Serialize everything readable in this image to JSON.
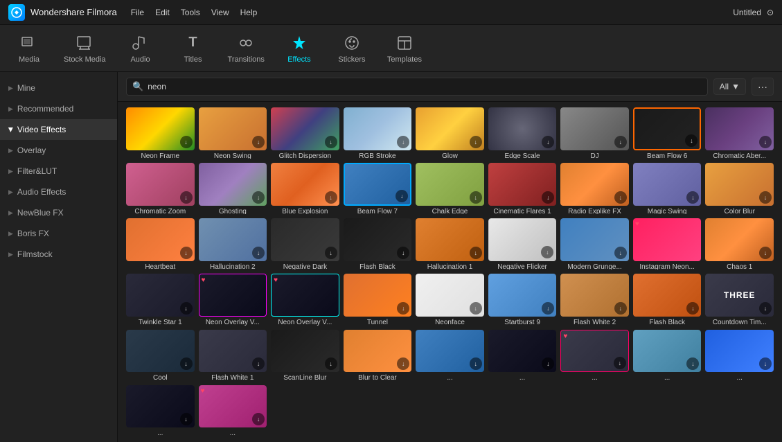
{
  "app": {
    "brand": "Wondershare Filmora",
    "title": "Untitled"
  },
  "menu": {
    "items": [
      "File",
      "Edit",
      "Tools",
      "View",
      "Help"
    ]
  },
  "toolbar": {
    "items": [
      {
        "id": "media",
        "label": "Media",
        "icon": "🎬"
      },
      {
        "id": "stock-media",
        "label": "Stock Media",
        "icon": "🗂"
      },
      {
        "id": "audio",
        "label": "Audio",
        "icon": "🎵"
      },
      {
        "id": "titles",
        "label": "Titles",
        "icon": "T"
      },
      {
        "id": "transitions",
        "label": "Transitions",
        "icon": "⟷"
      },
      {
        "id": "effects",
        "label": "Effects",
        "icon": "✦"
      },
      {
        "id": "stickers",
        "label": "Stickers",
        "icon": "🌀"
      },
      {
        "id": "templates",
        "label": "Templates",
        "icon": "⬜"
      }
    ]
  },
  "sidebar": {
    "items": [
      {
        "id": "mine",
        "label": "Mine",
        "expanded": false
      },
      {
        "id": "recommended",
        "label": "Recommended",
        "expanded": false
      },
      {
        "id": "video-effects",
        "label": "Video Effects",
        "expanded": true,
        "active": true
      },
      {
        "id": "overlay",
        "label": "Overlay",
        "expanded": false
      },
      {
        "id": "filter-lut",
        "label": "Filter&LUT",
        "expanded": false
      },
      {
        "id": "audio-effects",
        "label": "Audio Effects",
        "expanded": false
      },
      {
        "id": "newblue-fx",
        "label": "NewBlue FX",
        "expanded": false
      },
      {
        "id": "boris-fx",
        "label": "Boris FX",
        "expanded": false
      },
      {
        "id": "filmstock",
        "label": "Filmstock",
        "expanded": false
      }
    ]
  },
  "search": {
    "value": "neon",
    "placeholder": "neon",
    "filter": "All"
  },
  "effects": [
    {
      "id": "neon-frame",
      "name": "Neon Frame",
      "thumb": "thumb-neon-frame",
      "hasDownload": true,
      "hasHeart": false,
      "selected": false
    },
    {
      "id": "neon-swing",
      "name": "Neon Swing",
      "thumb": "thumb-neon-swing",
      "hasDownload": true,
      "hasHeart": false,
      "selected": false
    },
    {
      "id": "glitch-dispersion",
      "name": "Glitch Dispersion",
      "thumb": "thumb-glitch-disp",
      "hasDownload": true,
      "hasHeart": false,
      "selected": false
    },
    {
      "id": "rgb-stroke",
      "name": "RGB Stroke",
      "thumb": "thumb-rgb-stroke",
      "hasDownload": true,
      "hasHeart": false,
      "selected": false
    },
    {
      "id": "glow",
      "name": "Glow",
      "thumb": "thumb-glow",
      "hasDownload": true,
      "hasHeart": false,
      "selected": false
    },
    {
      "id": "edge-scale",
      "name": "Edge Scale",
      "thumb": "thumb-edge-scale",
      "hasDownload": true,
      "hasHeart": false,
      "selected": false
    },
    {
      "id": "dj",
      "name": "DJ",
      "thumb": "thumb-dj",
      "hasDownload": true,
      "hasHeart": false,
      "selected": false
    },
    {
      "id": "beam-flow6",
      "name": "Beam Flow 6",
      "thumb": "thumb-beam-flow6",
      "hasDownload": true,
      "hasHeart": false,
      "selected": true
    },
    {
      "id": "chromatic-aberration",
      "name": "Chromatic Aber...",
      "thumb": "thumb-chromatic-aber",
      "hasDownload": true,
      "hasHeart": false,
      "selected": false
    },
    {
      "id": "chromatic-zoom",
      "name": "Chromatic Zoom",
      "thumb": "thumb-chromatic-zoom",
      "hasDownload": true,
      "hasHeart": false,
      "selected": false
    },
    {
      "id": "ghosting",
      "name": "Ghosting",
      "thumb": "thumb-ghosting",
      "hasDownload": true,
      "hasHeart": false,
      "selected": false
    },
    {
      "id": "blue-explosion",
      "name": "Blue Explosion",
      "thumb": "thumb-blue-explosion",
      "hasDownload": true,
      "hasHeart": false,
      "selected": false
    },
    {
      "id": "beam-flow7",
      "name": "Beam Flow 7",
      "thumb": "thumb-beam-flow7",
      "hasDownload": true,
      "hasHeart": false,
      "selected": false
    },
    {
      "id": "chalk-edge",
      "name": "Chalk Edge",
      "thumb": "thumb-chalk-edge",
      "hasDownload": true,
      "hasHeart": false,
      "selected": false
    },
    {
      "id": "cinematic-flares",
      "name": "Cinematic Flares 1",
      "thumb": "thumb-cinematic",
      "hasDownload": true,
      "hasHeart": false,
      "selected": false
    },
    {
      "id": "radio-explike",
      "name": "Radio Explike FX",
      "thumb": "thumb-radio-explike",
      "hasDownload": true,
      "hasHeart": false,
      "selected": false
    },
    {
      "id": "magic-swing",
      "name": "Magic Swing",
      "thumb": "thumb-magic-swing",
      "hasDownload": true,
      "hasHeart": false,
      "selected": false
    },
    {
      "id": "color-blur",
      "name": "Color Blur",
      "thumb": "thumb-color-blur",
      "hasDownload": true,
      "hasHeart": false,
      "selected": false
    },
    {
      "id": "heartbeat",
      "name": "Heartbeat",
      "thumb": "thumb-heartbeat",
      "hasDownload": true,
      "hasHeart": false,
      "selected": false
    },
    {
      "id": "hallucination2",
      "name": "Hallucination 2",
      "thumb": "thumb-hallucination2",
      "hasDownload": true,
      "hasHeart": false,
      "selected": false
    },
    {
      "id": "negative-dark",
      "name": "Negative Dark",
      "thumb": "thumb-negative-dark",
      "hasDownload": true,
      "hasHeart": false,
      "selected": false
    },
    {
      "id": "flash-black",
      "name": "Flash Black",
      "thumb": "thumb-flash-black",
      "hasDownload": true,
      "hasHeart": false,
      "selected": false
    },
    {
      "id": "hallucination1",
      "name": "Hallucination 1",
      "thumb": "thumb-hallucination1",
      "hasDownload": true,
      "hasHeart": false,
      "selected": false
    },
    {
      "id": "negative-flicker",
      "name": "Negative Flicker",
      "thumb": "thumb-negative-flicker",
      "hasDownload": true,
      "hasHeart": false,
      "selected": false
    },
    {
      "id": "modern-grunge",
      "name": "Modern Grunge...",
      "thumb": "thumb-modern-grunge",
      "hasDownload": true,
      "hasHeart": false,
      "selected": false
    },
    {
      "id": "instagram-neon",
      "name": "Instagram Neon...",
      "thumb": "thumb-instagram-neon",
      "hasDownload": false,
      "hasHeart": true,
      "selected": false
    },
    {
      "id": "chaos1",
      "name": "Chaos 1",
      "thumb": "thumb-chaos1",
      "hasDownload": true,
      "hasHeart": false,
      "selected": false
    },
    {
      "id": "twinkle-star",
      "name": "Twinkle Star 1",
      "thumb": "thumb-twinkle-star",
      "hasDownload": true,
      "hasHeart": false,
      "selected": false
    },
    {
      "id": "neon-overlay-v1",
      "name": "Neon Overlay V...",
      "thumb": "thumb-neon-overlay-v1",
      "hasDownload": false,
      "hasHeart": true,
      "selected": false
    },
    {
      "id": "neon-overlay-v2",
      "name": "Neon Overlay V...",
      "thumb": "thumb-neon-overlay-v2",
      "hasDownload": false,
      "hasHeart": true,
      "selected": false
    },
    {
      "id": "tunnel",
      "name": "Tunnel",
      "thumb": "thumb-tunnel",
      "hasDownload": true,
      "hasHeart": false,
      "selected": false
    },
    {
      "id": "neonface",
      "name": "Neonface",
      "thumb": "thumb-neonface",
      "hasDownload": true,
      "hasHeart": false,
      "selected": false
    },
    {
      "id": "startburst9",
      "name": "Startburst 9",
      "thumb": "thumb-startburst",
      "hasDownload": true,
      "hasHeart": false,
      "selected": false
    },
    {
      "id": "flash-white2",
      "name": "Flash White 2",
      "thumb": "thumb-flash-white2",
      "hasDownload": true,
      "hasHeart": false,
      "selected": false
    },
    {
      "id": "flash-black2",
      "name": "Flash Black",
      "thumb": "thumb-flash-black2",
      "hasDownload": true,
      "hasHeart": false,
      "selected": false
    },
    {
      "id": "countdown-time",
      "name": "Countdown Tim...",
      "thumb": "thumb-countdown",
      "hasDownload": true,
      "hasHeart": false,
      "selected": false,
      "label": "THREE"
    },
    {
      "id": "cool",
      "name": "Cool",
      "thumb": "thumb-cool",
      "hasDownload": true,
      "hasHeart": false,
      "selected": false
    },
    {
      "id": "flash-white1",
      "name": "Flash White 1",
      "thumb": "thumb-flash-white1",
      "hasDownload": true,
      "hasHeart": false,
      "selected": false
    },
    {
      "id": "scanline-blur",
      "name": "ScanLine Blur",
      "thumb": "thumb-scanline",
      "hasDownload": true,
      "hasHeart": false,
      "selected": false
    },
    {
      "id": "blur-to-clear",
      "name": "Blur to Clear",
      "thumb": "thumb-blur-to-clear",
      "hasDownload": true,
      "hasHeart": false,
      "selected": false
    },
    {
      "id": "bottom1",
      "name": "...",
      "thumb": "thumb-bottom1",
      "hasDownload": true,
      "hasHeart": false,
      "selected": false
    },
    {
      "id": "bottom2",
      "name": "...",
      "thumb": "thumb-bottom2",
      "hasDownload": true,
      "hasHeart": false,
      "selected": false
    },
    {
      "id": "bottom3",
      "name": "...",
      "thumb": "thumb-bottom3",
      "hasDownload": true,
      "hasHeart": true,
      "selected": false
    },
    {
      "id": "bottom4",
      "name": "...",
      "thumb": "thumb-bottom4",
      "hasDownload": true,
      "hasHeart": false,
      "selected": false
    },
    {
      "id": "bottom5",
      "name": "...",
      "thumb": "thumb-bottom5",
      "hasDownload": true,
      "hasHeart": false,
      "selected": false
    },
    {
      "id": "bottom6",
      "name": "...",
      "thumb": "thumb-bottom6",
      "hasDownload": true,
      "hasHeart": false,
      "selected": false
    },
    {
      "id": "bottom7",
      "name": "...",
      "thumb": "thumb-bottom7",
      "hasDownload": true,
      "hasHeart": true,
      "selected": false
    }
  ],
  "icons": {
    "arrow_right": "▶",
    "arrow_down": "▼",
    "search": "🔍",
    "download": "⬇",
    "heart": "♥",
    "more": "···",
    "chevron_left": "‹"
  }
}
